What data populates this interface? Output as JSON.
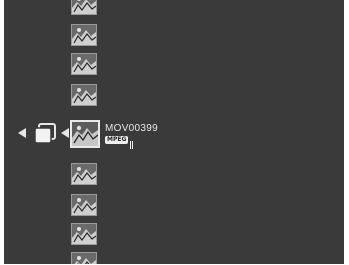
{
  "file_list": {
    "selected": {
      "file_name": "MOV00399",
      "format_badge": "MPEG"
    },
    "thumbnails_above": 4,
    "thumbnails_below": 4
  },
  "icons": {
    "nav_left": "left-arrow-icon",
    "folder": "folder-stack-icon",
    "selection_pointer": "left-arrow-icon"
  },
  "colors": {
    "screen_background": "#3a3a3a",
    "text": "#e8e8e8",
    "selected_border": "#e9e9e9"
  }
}
